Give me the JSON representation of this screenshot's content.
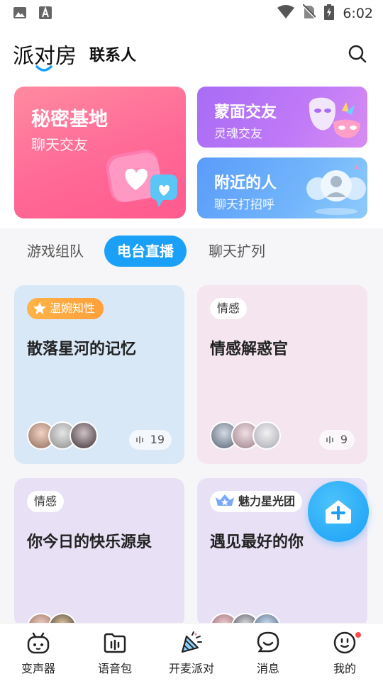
{
  "status_bar": {
    "time": "6:02"
  },
  "header": {
    "title": "派对房",
    "contacts_tab": "联系人"
  },
  "feature_cards": {
    "secret_base": {
      "title": "秘密基地",
      "subtitle": "聊天交友"
    },
    "masked": {
      "title": "蒙面交友",
      "subtitle": "灵魂交友"
    },
    "nearby": {
      "title": "附近的人",
      "subtitle": "聊天打招呼"
    }
  },
  "tabs": [
    "游戏组队",
    "电台直播",
    "聊天扩列"
  ],
  "active_tab": "电台直播",
  "rooms": [
    {
      "tag": "温婉知性",
      "tag_style": "orange",
      "title": "散落星河的记忆",
      "count": "19",
      "bg": "#d9e8f7"
    },
    {
      "tag": "情感",
      "tag_style": "plain",
      "title": "情感解惑官",
      "count": "9",
      "bg": "#f4e5ee"
    },
    {
      "tag": "情感",
      "tag_style": "plain",
      "title": "你今日的快乐源泉",
      "count": "",
      "bg": "#e8e1f6"
    },
    {
      "tag": "魅力星光团",
      "tag_style": "badge",
      "title": "遇见最好的你",
      "count": "",
      "bg": "#e8e1f6"
    }
  ],
  "bottom_nav": [
    {
      "label": "变声器",
      "icon": "robot-face-icon"
    },
    {
      "label": "语音包",
      "icon": "folder-audio-icon"
    },
    {
      "label": "开麦派对",
      "icon": "party-horn-icon"
    },
    {
      "label": "消息",
      "icon": "chat-bubble-icon"
    },
    {
      "label": "我的",
      "icon": "profile-face-icon"
    }
  ],
  "colors": {
    "accent": "#1aa0f6"
  }
}
